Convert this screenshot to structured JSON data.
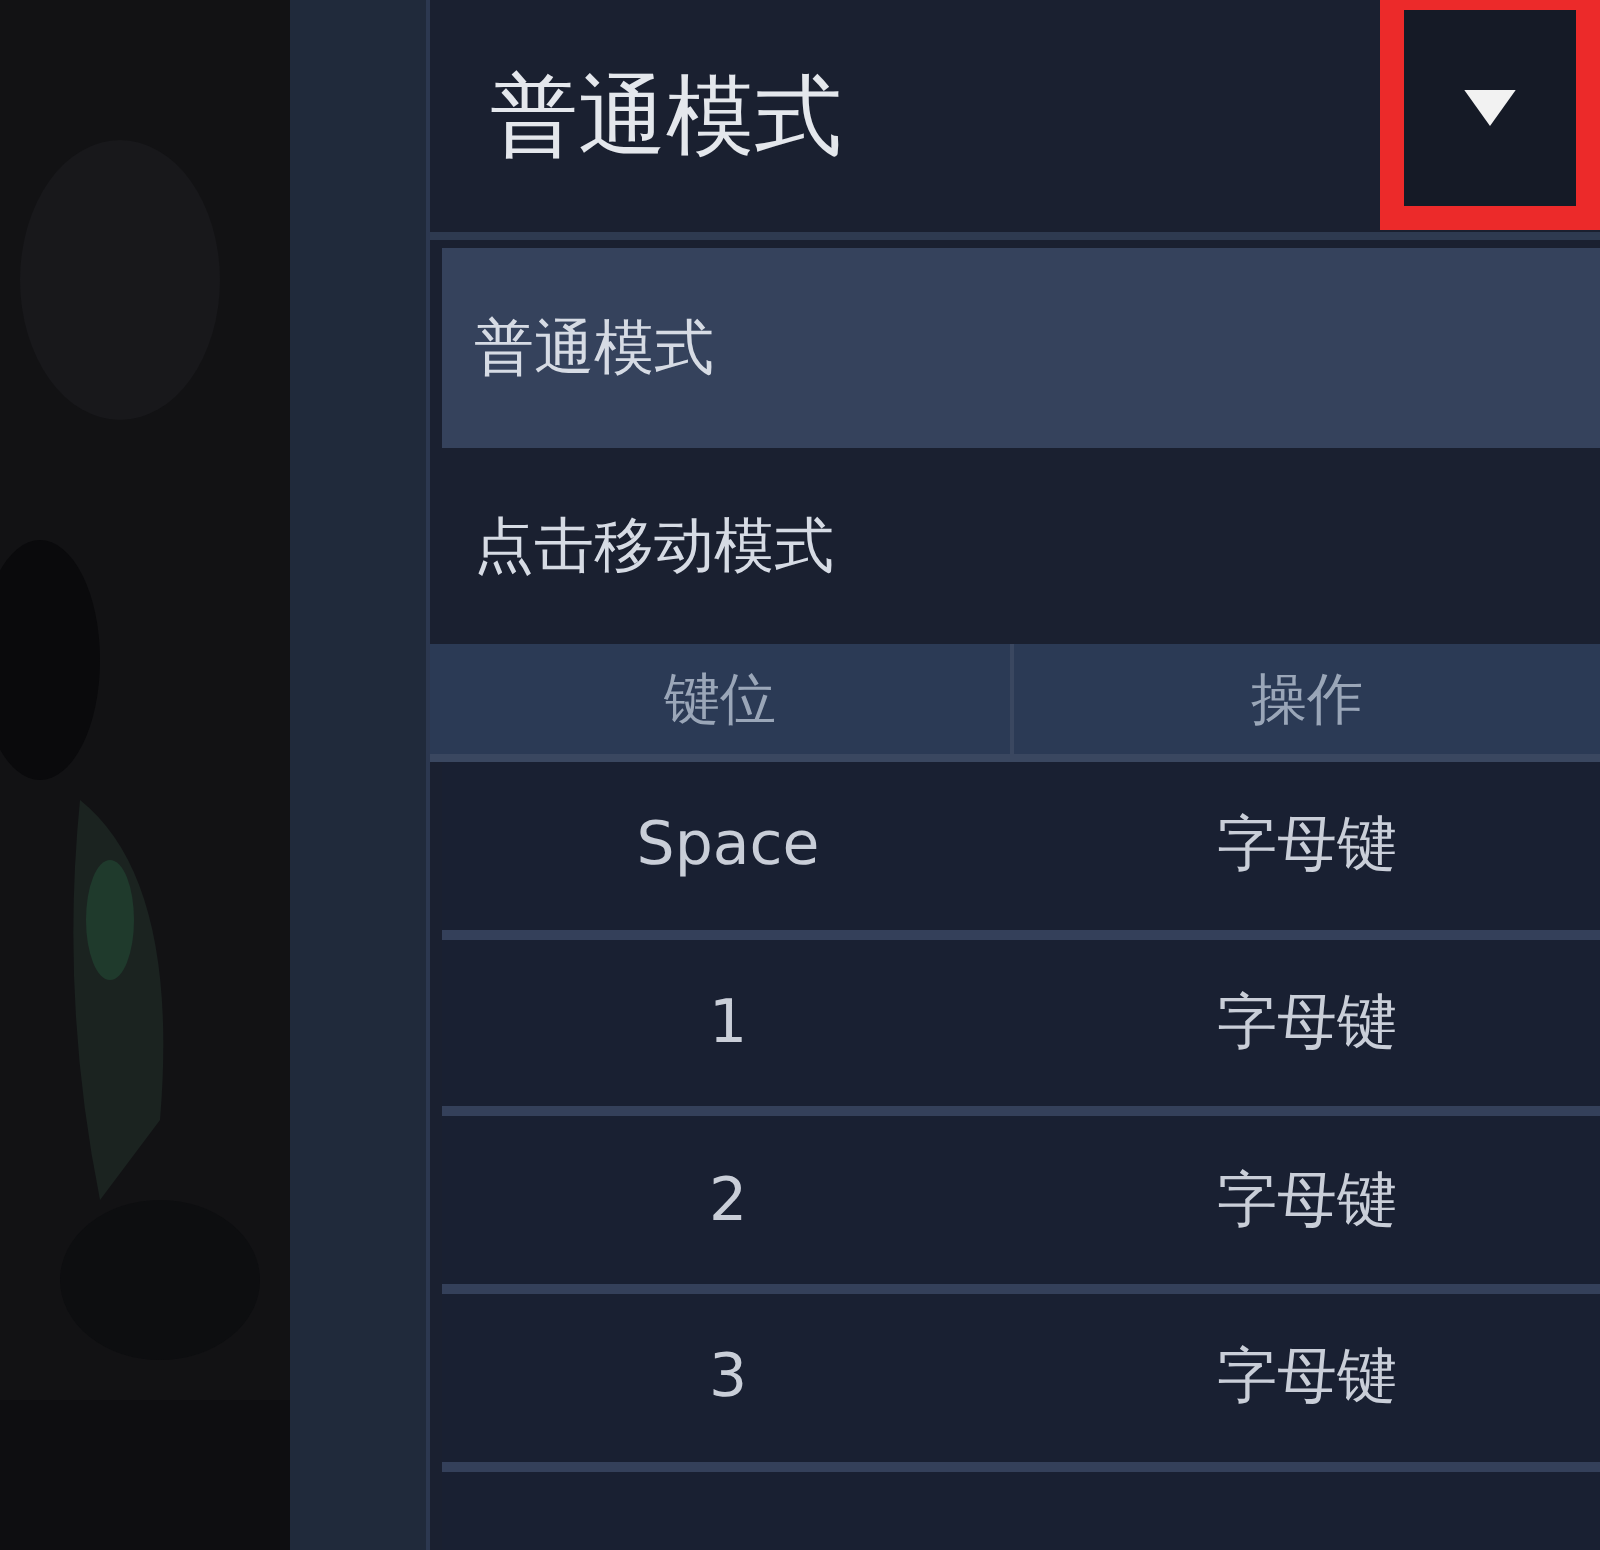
{
  "mode_select": {
    "value": "普通模式",
    "highlighted": true
  },
  "options": [
    {
      "label": "普通模式",
      "selected": true
    },
    {
      "label": "点击移动模式",
      "selected": false
    }
  ],
  "table": {
    "columns": [
      "键位",
      "操作"
    ],
    "rows": [
      [
        "Space",
        "字母键"
      ],
      [
        "1",
        "字母键"
      ],
      [
        "2",
        "字母键"
      ],
      [
        "3",
        "字母键"
      ]
    ]
  }
}
